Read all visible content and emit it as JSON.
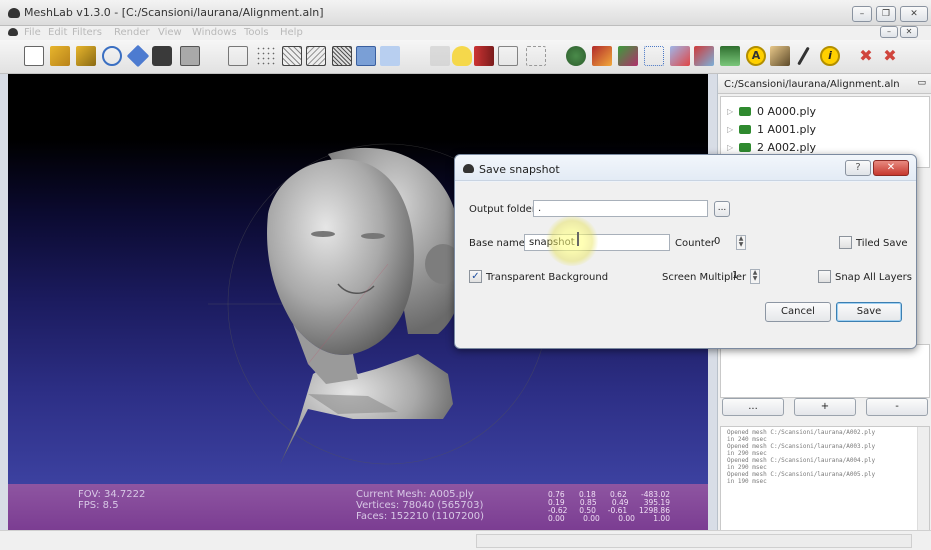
{
  "window": {
    "title": "MeshLab v1.3.0 - [C:/Scansioni/laurana/Alignment.aln]"
  },
  "menu": [
    "File",
    "Edit",
    "Filters",
    "Render",
    "View",
    "Windows",
    "Tools",
    "Help"
  ],
  "viewport_info": {
    "fov": "FOV: 34.7222",
    "fps": "FPS:   8.5",
    "current_mesh": "Current Mesh: A005.ply",
    "vertices": "Vertices: 78040 (565703)",
    "faces": "Faces: 152210 (1107200)",
    "matrix": [
      [
        "0.76",
        "0.18",
        "0.62",
        "-483.02"
      ],
      [
        "0.19",
        "0.85",
        "0.49",
        "395.19"
      ],
      [
        "-0.62",
        "0.50",
        "-0.61",
        "1298.86"
      ],
      [
        "0.00",
        "0.00",
        "0.00",
        "1.00"
      ]
    ]
  },
  "layer_panel": {
    "header": "C:/Scansioni/laurana/Alignment.aln",
    "layers": [
      {
        "label": "0  A000.ply"
      },
      {
        "label": "1  A001.ply"
      },
      {
        "label": "2  A002.ply"
      }
    ],
    "buttons": [
      "...",
      "+",
      "-"
    ]
  },
  "log": [
    "Opened mesh C:/Scansioni/laurana/A002.ply",
    "in 240 msec",
    "Opened mesh C:/Scansioni/laurana/A003.ply",
    "in 290 msec",
    "Opened mesh C:/Scansioni/laurana/A004.ply",
    "in 290 msec",
    "Opened mesh C:/Scansioni/laurana/A005.ply",
    "in 190 msec"
  ],
  "dialog": {
    "title": "Save snapshot",
    "output_folder_label": "Output folder",
    "output_folder_value": ".",
    "browse_label": "...",
    "base_name_label": "Base name",
    "base_name_value": "snapshot",
    "counter_label": "Counter",
    "counter_value": "0",
    "tiled_save_label": "Tiled Save",
    "tiled_save_checked": false,
    "transparent_bg_label": "Transparent Background",
    "transparent_bg_checked": true,
    "screen_multiplier_label": "Screen Multiplier",
    "screen_multiplier_value": "1",
    "snap_all_layers_label": "Snap All Layers",
    "snap_all_layers_checked": false,
    "cancel_label": "Cancel",
    "save_label": "Save",
    "help_label": "?",
    "close_label": "✕"
  },
  "title_buttons": {
    "minimize": "–",
    "maximize": "❐",
    "close": "✕"
  },
  "colors": {
    "viewport_top": "#000000",
    "viewport_bottom": "#3c41a0",
    "status_purple": "#84469a",
    "close_red": "#d0453d"
  }
}
